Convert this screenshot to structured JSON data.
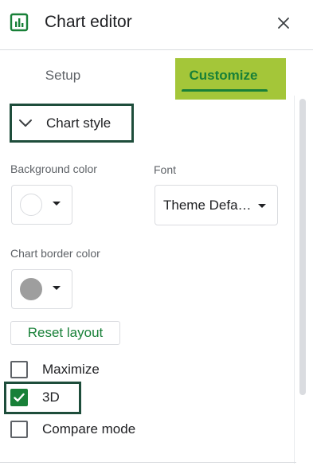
{
  "header": {
    "title": "Chart editor",
    "icon": "chart-editor-icon",
    "close_icon": "close-icon"
  },
  "tabs": [
    {
      "label": "Setup",
      "active": false
    },
    {
      "label": "Customize",
      "active": true
    }
  ],
  "section": {
    "title": "Chart style",
    "expanded": true,
    "icon": "chevron-down-icon"
  },
  "background_color": {
    "label": "Background color",
    "value": "#ffffff"
  },
  "font": {
    "label": "Font",
    "value": "Theme Defa…"
  },
  "chart_border_color": {
    "label": "Chart border color",
    "value": "#9e9e9e"
  },
  "reset_button": {
    "label": "Reset layout"
  },
  "checkboxes": [
    {
      "label": "Maximize",
      "checked": false
    },
    {
      "label": "3D",
      "checked": true
    },
    {
      "label": "Compare mode",
      "checked": false
    }
  ],
  "colors": {
    "accent": "#188038",
    "tab_highlight": "#a4c639",
    "annotation_border": "#1e4d3b"
  }
}
